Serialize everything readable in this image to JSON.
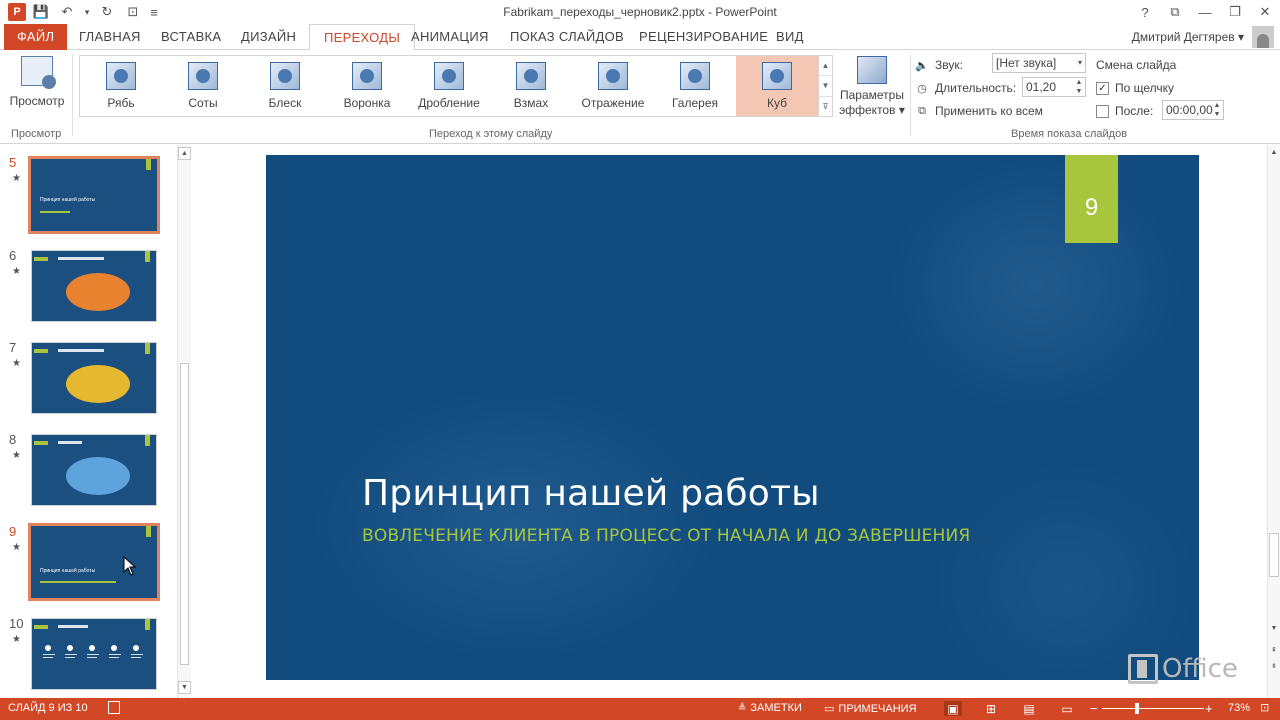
{
  "app": {
    "logo_letter": "P",
    "doc_title": "Fabrikam_переходы_черновик2.pptx - PowerPoint",
    "user": "Дмитрий Дегтярев",
    "win_help": "?",
    "win_restore": "⧉",
    "win_min": "—",
    "win_max": "❐",
    "win_close": "✕"
  },
  "qat": {
    "save": "💾",
    "undo": "↶",
    "undo_drop": "▾",
    "redo": "↻",
    "start": "⊡",
    "customize": "≡"
  },
  "tabs": {
    "file": "ФАЙЛ",
    "home": "ГЛАВНАЯ",
    "insert": "ВСТАВКА",
    "design": "ДИЗАЙН",
    "transitions": "ПЕРЕХОДЫ",
    "animation": "АНИМАЦИЯ",
    "slideshow": "ПОКАЗ СЛАЙДОВ",
    "review": "РЕЦЕНЗИРОВАНИЕ",
    "view": "ВИД",
    "user_dropdown": "▾"
  },
  "ribbon": {
    "preview_label": "Просмотр",
    "preview_group": "Просмотр",
    "gallery_group": "Переход к этому слайду",
    "gallery": [
      {
        "label": "Рябь"
      },
      {
        "label": "Соты"
      },
      {
        "label": "Блеск"
      },
      {
        "label": "Воронка"
      },
      {
        "label": "Дробление"
      },
      {
        "label": "Взмах"
      },
      {
        "label": "Отражение"
      },
      {
        "label": "Галерея"
      },
      {
        "label": "Куб"
      }
    ],
    "gallery_up": "▲",
    "gallery_down": "▼",
    "gallery_more": "⊽",
    "effects_label_1": "Параметры",
    "effects_label_2": "эффектов ▾",
    "sound_label": "Звук:",
    "sound_value": "[Нет звука]",
    "duration_label": "Длительность:",
    "duration_value": "01,20",
    "apply_all": "Применить ко всем",
    "timing_group": "Время показа слайдов",
    "advance_title": "Смена слайда",
    "on_click_label": "По щелчку",
    "on_click_checked": "✓",
    "after_label": "После:",
    "after_value": "00:00,00",
    "combo_arrow": "▾",
    "spin_up": "▲",
    "spin_down": "▼"
  },
  "thumbnails": [
    {
      "num": "5",
      "star": "★",
      "title": "Принцип нашей работы",
      "selected": true
    },
    {
      "num": "6",
      "star": "★",
      "blob": "#e8822e"
    },
    {
      "num": "7",
      "star": "★",
      "blob": "#e5b82f"
    },
    {
      "num": "8",
      "star": "★",
      "blob": "#5fa3dc"
    },
    {
      "num": "9",
      "star": "★",
      "title": "Принцип нашей работы",
      "selected": true
    },
    {
      "num": "10",
      "star": "★"
    }
  ],
  "thumb_scroll": {
    "up": "▲",
    "down": "▼"
  },
  "slide": {
    "number": "9",
    "title": "Принцип нашей работы",
    "subtitle": "ВОВЛЕЧЕНИЕ КЛИЕНТА В ПРОЦЕСС ОТ НАЧАЛА И ДО ЗАВЕРШЕНИЯ",
    "bg": "#124b7d",
    "accent": "#a7c63b"
  },
  "right_scroll": {
    "up": "▲",
    "down": "▼",
    "prev": "⇞",
    "next": "⇟"
  },
  "watermark": "Office",
  "status": {
    "slide_counter": "СЛАЙД 9 ИЗ 10",
    "notes": "ЗАМЕТКИ",
    "comments": "ПРИМЕЧАНИЯ",
    "zoom_minus": "−",
    "zoom_plus": "+",
    "zoom": "73%",
    "fit": "⊡"
  },
  "colors": {
    "brand": "#d24726",
    "selected_item": "#f4c7b5"
  }
}
